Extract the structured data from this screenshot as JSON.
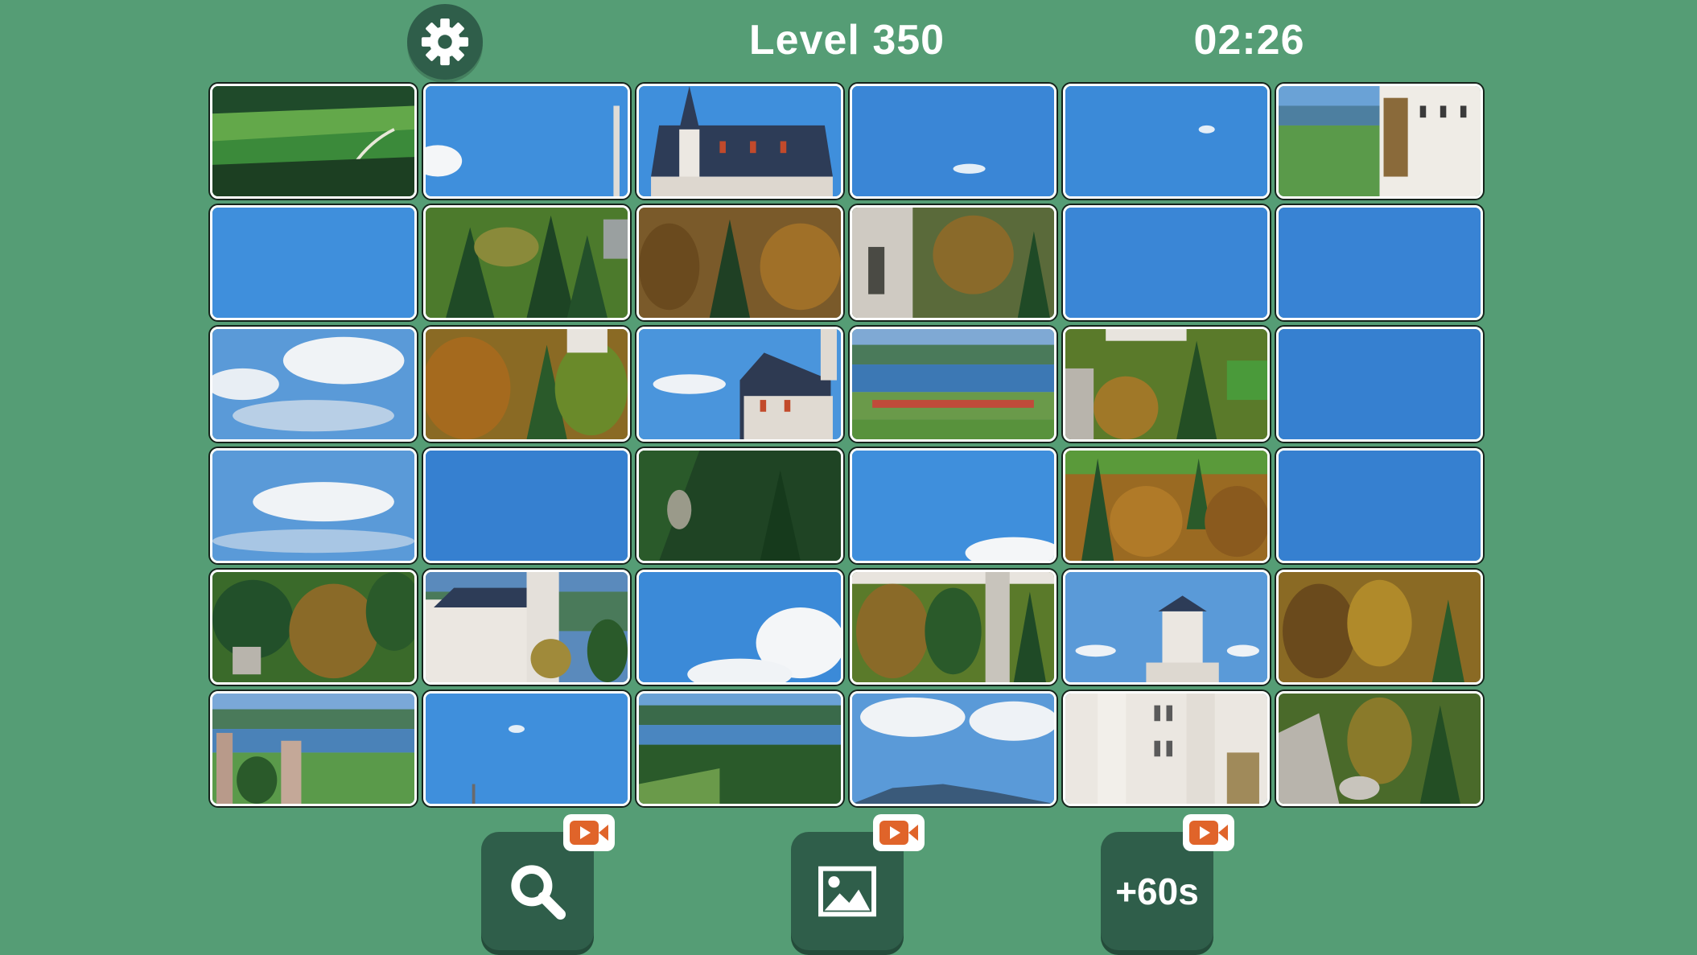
{
  "header": {
    "level": "Level 350",
    "timer": "02:26",
    "settings_icon": "gear-icon"
  },
  "puzzle": {
    "rows": 6,
    "columns": 6,
    "tiles": [
      "meadow-forest-path",
      "sky-cloud",
      "castle-roof-spires",
      "sky",
      "sky",
      "castle-tower-lake",
      "sky",
      "forest",
      "autumn-forest",
      "castle-cliff-forest",
      "sky",
      "sky",
      "sky-clouds",
      "autumn-forest-tower",
      "castle-roof-clouds",
      "lake-village",
      "cliff-forest-meadow",
      "sky",
      "sky-clouds",
      "sky",
      "dark-forest",
      "sky-cloud-bottom",
      "autumn-forest-meadow",
      "sky",
      "forest-cliff",
      "castle-facade",
      "sky-clouds-bottom",
      "cliff-forest",
      "castle-tower-top",
      "autumn-forest",
      "castle-towers-lake",
      "sky-spire",
      "lake-hills",
      "clouds-mountain",
      "castle-facade-large",
      "cliff-forest"
    ]
  },
  "toolbar": {
    "magnifier": {
      "icon": "search-icon",
      "badge_icon": "video-ad-icon"
    },
    "preview": {
      "icon": "image-icon",
      "badge_icon": "video-ad-icon"
    },
    "add_time": {
      "label": "+60s",
      "badge_icon": "video-ad-icon"
    }
  },
  "colors": {
    "background": "#559d75",
    "button": "#2f5e4a",
    "badge_play": "#e0642a",
    "sky": "#3a8ad6"
  }
}
